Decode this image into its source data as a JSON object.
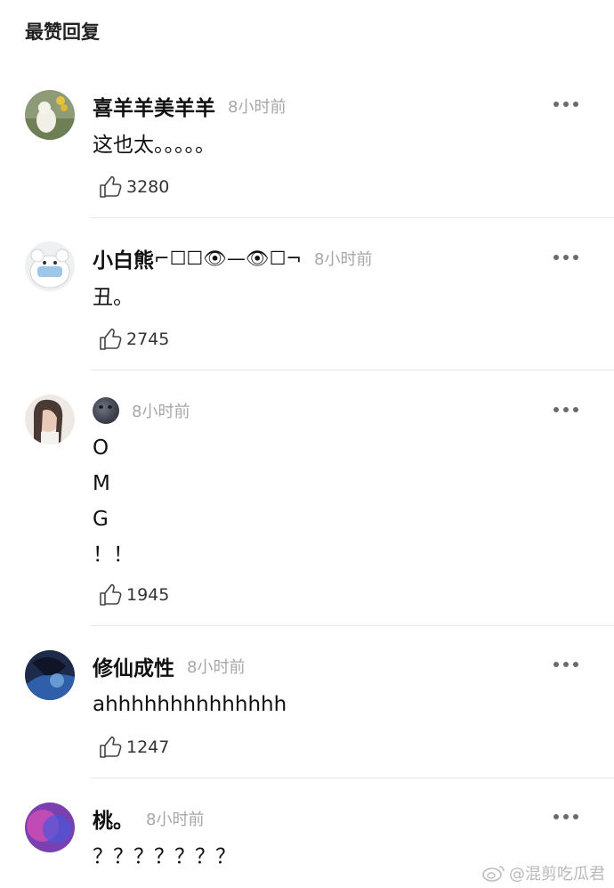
{
  "header": {
    "title": "最赞回复"
  },
  "comments": [
    {
      "username": "喜羊羊美羊羊",
      "time": "8小时前",
      "content": "这也太。。。。。",
      "likes": "3280"
    },
    {
      "username": "小白熊",
      "username_emoji": "⌐☐☐👁—👁☐¬",
      "time": "8小时前",
      "content": "丑。",
      "likes": "2745"
    },
    {
      "username_icon": "new-moon-face-emoji",
      "time": "8小时前",
      "content": "O\nM\nG\n！！",
      "likes": "1945"
    },
    {
      "username": "修仙成性",
      "time": "8小时前",
      "content": "ahhhhhhhhhhhhhh",
      "likes": "1247"
    },
    {
      "username": "桃。",
      "time": "8小时前",
      "content": "？？？？？？？",
      "likes": ""
    }
  ],
  "watermark": {
    "text": "@混剪吃瓜君"
  },
  "colors": {
    "text": "#111111",
    "meta": "#a7a7a7",
    "divider": "#e6e6e6"
  }
}
